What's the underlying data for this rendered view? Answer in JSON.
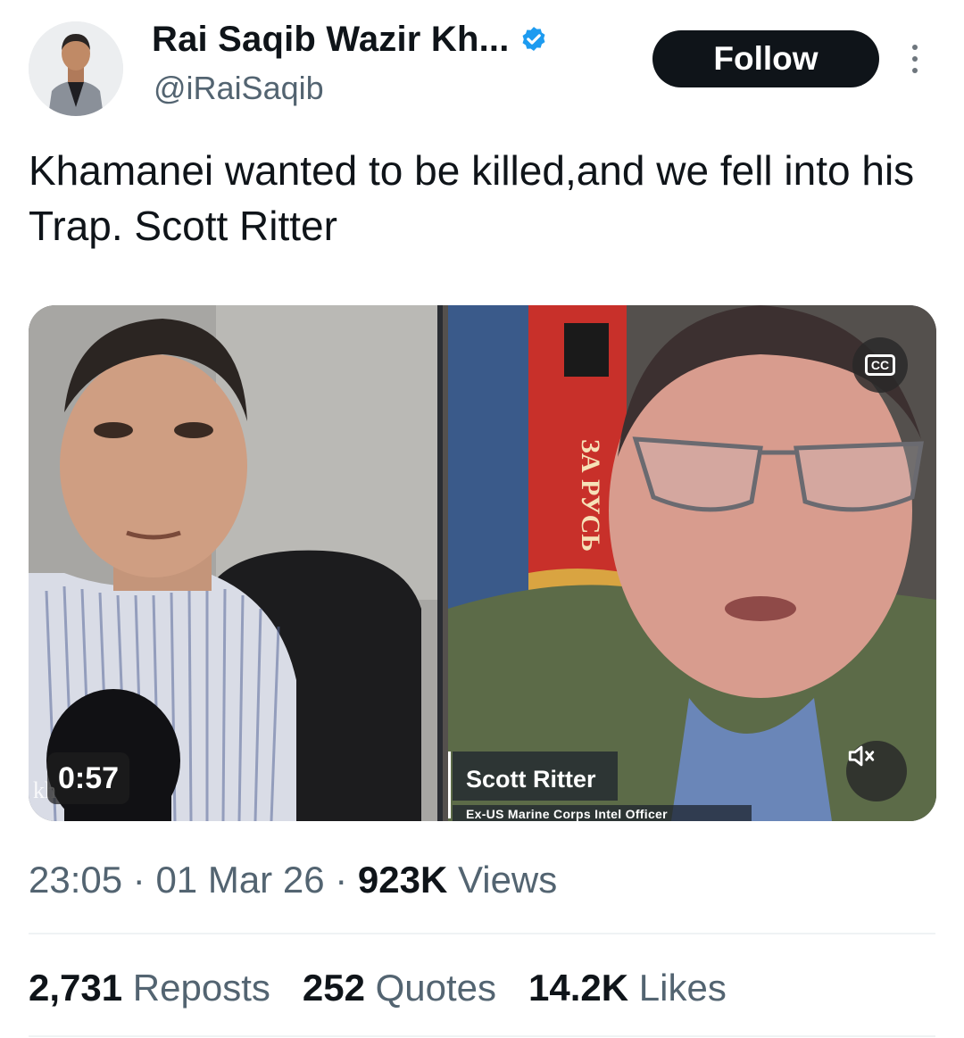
{
  "author": {
    "display_name": "Rai Saqib Wazir Kh...",
    "handle": "@iRaiSaqib",
    "verified": true
  },
  "follow_label": "Follow",
  "tweet_text": "Khamanei wanted to be killed,and we fell into his Trap. Scott Ritter",
  "media": {
    "duration": "0:57",
    "cc_label": "CC",
    "lower_third_name": "Scott Ritter",
    "lower_third_sub": "Ex-US Marine Corps Intel Officer",
    "banner_text": "ЗА РУСЬ"
  },
  "meta": {
    "time": "23:05",
    "sep1": "·",
    "date": "01 Mar 26",
    "sep2": "·",
    "views_count": "923K",
    "views_label": "Views"
  },
  "stats": {
    "reposts_count": "2,731",
    "reposts_label": "Reposts",
    "quotes_count": "252",
    "quotes_label": "Quotes",
    "likes_count": "14.2K",
    "likes_label": "Likes"
  },
  "colors": {
    "text_primary": "#0f1419",
    "text_secondary": "#536471",
    "verified_blue": "#1d9bf0",
    "follow_bg": "#0f1419",
    "divider": "#eff3f4"
  }
}
